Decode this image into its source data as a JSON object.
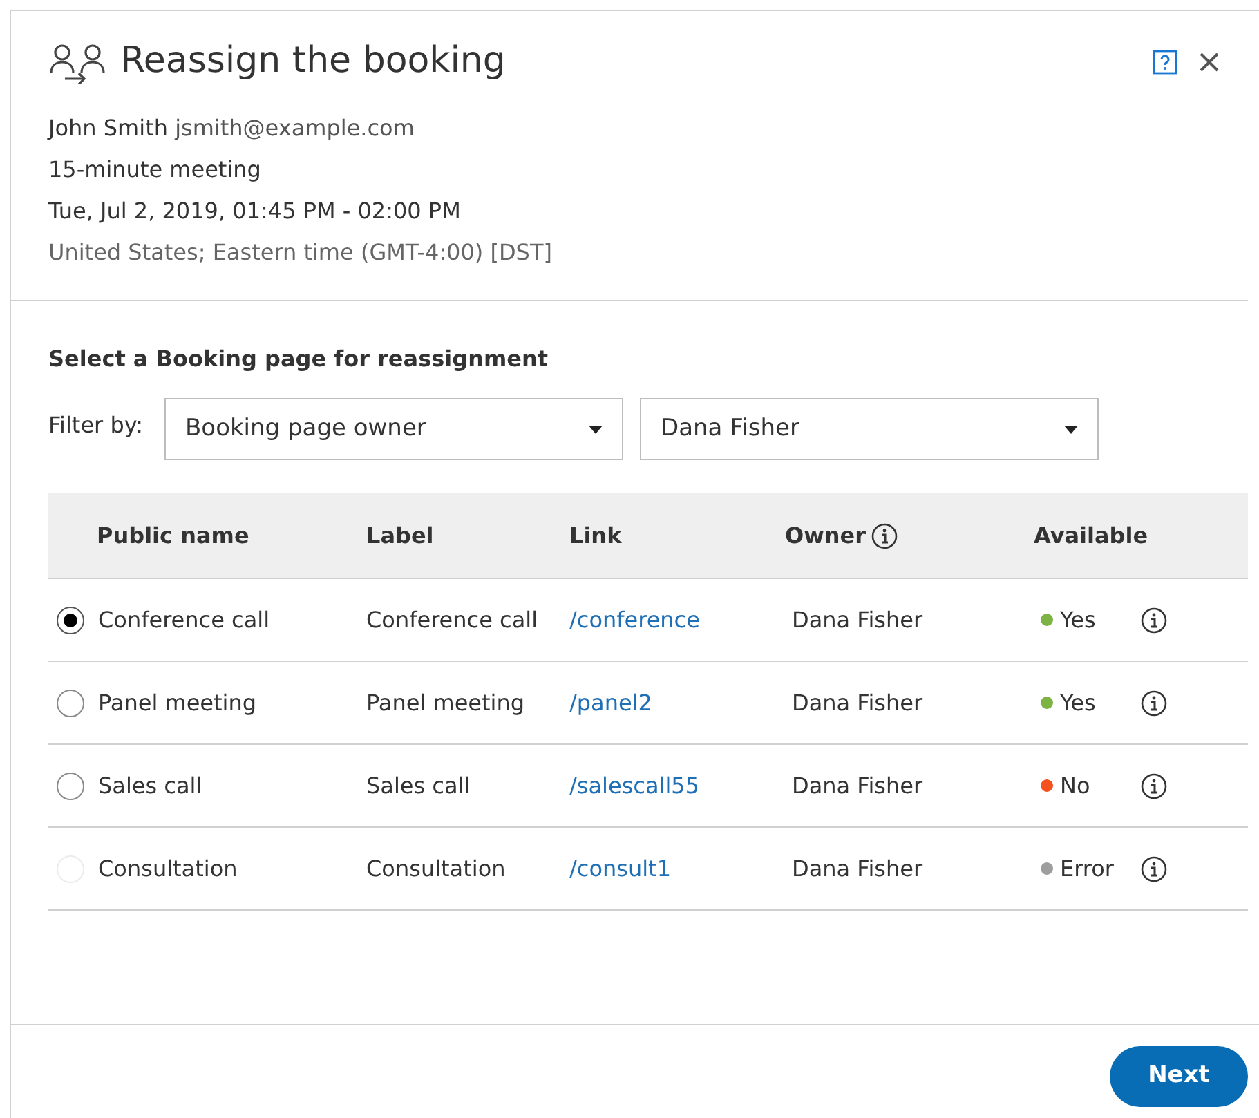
{
  "dialog": {
    "title": "Reassign the booking"
  },
  "booking": {
    "name": "John Smith",
    "email": "jsmith@example.com",
    "meeting": "15-minute meeting",
    "datetime": "Tue, Jul 2, 2019, 01:45 PM - 02:00 PM",
    "timezone": "United States; Eastern time (GMT-4:00) [DST]"
  },
  "section_title": "Select a Booking page for reassignment",
  "filter": {
    "label": "Filter by:",
    "field": "Booking page owner",
    "value": "Dana Fisher"
  },
  "table": {
    "columns": [
      "Public name",
      "Label",
      "Link",
      "Owner",
      "Available"
    ],
    "rows": [
      {
        "public_name": "Conference call",
        "label": "Conference call",
        "link": "/conference",
        "owner": "Dana Fisher",
        "available": "Yes",
        "color": "#7cb342",
        "selected": true,
        "disabled": false
      },
      {
        "public_name": "Panel meeting",
        "label": "Panel meeting",
        "link": "/panel2",
        "owner": "Dana Fisher",
        "available": "Yes",
        "color": "#7cb342",
        "selected": false,
        "disabled": false
      },
      {
        "public_name": "Sales call",
        "label": "Sales call",
        "link": "/salescall55",
        "owner": "Dana Fisher",
        "available": "No",
        "color": "#f4511e",
        "selected": false,
        "disabled": false
      },
      {
        "public_name": "Consultation",
        "label": "Consultation",
        "link": "/consult1",
        "owner": "Dana Fisher",
        "available": "Error",
        "color": "#9e9e9e",
        "selected": false,
        "disabled": true
      }
    ]
  },
  "buttons": [
    "Next"
  ]
}
